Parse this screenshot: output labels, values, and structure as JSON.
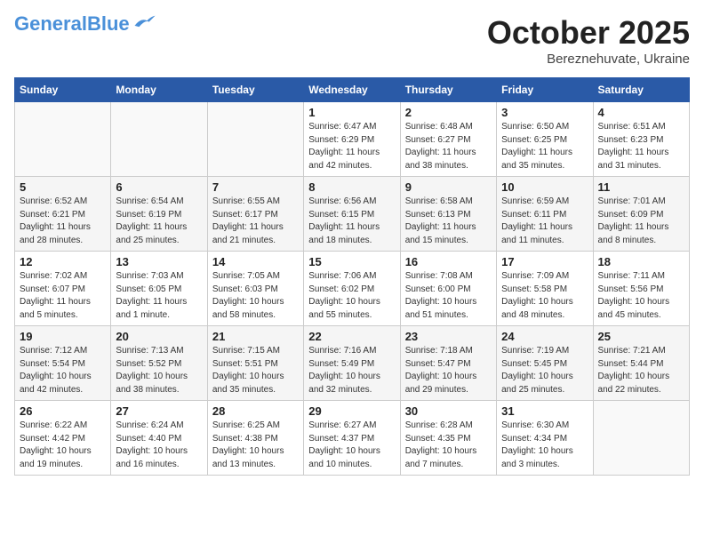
{
  "header": {
    "logo_line1": "General",
    "logo_line2": "Blue",
    "month": "October 2025",
    "location": "Bereznehuvate, Ukraine"
  },
  "weekdays": [
    "Sunday",
    "Monday",
    "Tuesday",
    "Wednesday",
    "Thursday",
    "Friday",
    "Saturday"
  ],
  "weeks": [
    [
      {
        "day": "",
        "info": ""
      },
      {
        "day": "",
        "info": ""
      },
      {
        "day": "",
        "info": ""
      },
      {
        "day": "1",
        "info": "Sunrise: 6:47 AM\nSunset: 6:29 PM\nDaylight: 11 hours\nand 42 minutes."
      },
      {
        "day": "2",
        "info": "Sunrise: 6:48 AM\nSunset: 6:27 PM\nDaylight: 11 hours\nand 38 minutes."
      },
      {
        "day": "3",
        "info": "Sunrise: 6:50 AM\nSunset: 6:25 PM\nDaylight: 11 hours\nand 35 minutes."
      },
      {
        "day": "4",
        "info": "Sunrise: 6:51 AM\nSunset: 6:23 PM\nDaylight: 11 hours\nand 31 minutes."
      }
    ],
    [
      {
        "day": "5",
        "info": "Sunrise: 6:52 AM\nSunset: 6:21 PM\nDaylight: 11 hours\nand 28 minutes."
      },
      {
        "day": "6",
        "info": "Sunrise: 6:54 AM\nSunset: 6:19 PM\nDaylight: 11 hours\nand 25 minutes."
      },
      {
        "day": "7",
        "info": "Sunrise: 6:55 AM\nSunset: 6:17 PM\nDaylight: 11 hours\nand 21 minutes."
      },
      {
        "day": "8",
        "info": "Sunrise: 6:56 AM\nSunset: 6:15 PM\nDaylight: 11 hours\nand 18 minutes."
      },
      {
        "day": "9",
        "info": "Sunrise: 6:58 AM\nSunset: 6:13 PM\nDaylight: 11 hours\nand 15 minutes."
      },
      {
        "day": "10",
        "info": "Sunrise: 6:59 AM\nSunset: 6:11 PM\nDaylight: 11 hours\nand 11 minutes."
      },
      {
        "day": "11",
        "info": "Sunrise: 7:01 AM\nSunset: 6:09 PM\nDaylight: 11 hours\nand 8 minutes."
      }
    ],
    [
      {
        "day": "12",
        "info": "Sunrise: 7:02 AM\nSunset: 6:07 PM\nDaylight: 11 hours\nand 5 minutes."
      },
      {
        "day": "13",
        "info": "Sunrise: 7:03 AM\nSunset: 6:05 PM\nDaylight: 11 hours\nand 1 minute."
      },
      {
        "day": "14",
        "info": "Sunrise: 7:05 AM\nSunset: 6:03 PM\nDaylight: 10 hours\nand 58 minutes."
      },
      {
        "day": "15",
        "info": "Sunrise: 7:06 AM\nSunset: 6:02 PM\nDaylight: 10 hours\nand 55 minutes."
      },
      {
        "day": "16",
        "info": "Sunrise: 7:08 AM\nSunset: 6:00 PM\nDaylight: 10 hours\nand 51 minutes."
      },
      {
        "day": "17",
        "info": "Sunrise: 7:09 AM\nSunset: 5:58 PM\nDaylight: 10 hours\nand 48 minutes."
      },
      {
        "day": "18",
        "info": "Sunrise: 7:11 AM\nSunset: 5:56 PM\nDaylight: 10 hours\nand 45 minutes."
      }
    ],
    [
      {
        "day": "19",
        "info": "Sunrise: 7:12 AM\nSunset: 5:54 PM\nDaylight: 10 hours\nand 42 minutes."
      },
      {
        "day": "20",
        "info": "Sunrise: 7:13 AM\nSunset: 5:52 PM\nDaylight: 10 hours\nand 38 minutes."
      },
      {
        "day": "21",
        "info": "Sunrise: 7:15 AM\nSunset: 5:51 PM\nDaylight: 10 hours\nand 35 minutes."
      },
      {
        "day": "22",
        "info": "Sunrise: 7:16 AM\nSunset: 5:49 PM\nDaylight: 10 hours\nand 32 minutes."
      },
      {
        "day": "23",
        "info": "Sunrise: 7:18 AM\nSunset: 5:47 PM\nDaylight: 10 hours\nand 29 minutes."
      },
      {
        "day": "24",
        "info": "Sunrise: 7:19 AM\nSunset: 5:45 PM\nDaylight: 10 hours\nand 25 minutes."
      },
      {
        "day": "25",
        "info": "Sunrise: 7:21 AM\nSunset: 5:44 PM\nDaylight: 10 hours\nand 22 minutes."
      }
    ],
    [
      {
        "day": "26",
        "info": "Sunrise: 6:22 AM\nSunset: 4:42 PM\nDaylight: 10 hours\nand 19 minutes."
      },
      {
        "day": "27",
        "info": "Sunrise: 6:24 AM\nSunset: 4:40 PM\nDaylight: 10 hours\nand 16 minutes."
      },
      {
        "day": "28",
        "info": "Sunrise: 6:25 AM\nSunset: 4:38 PM\nDaylight: 10 hours\nand 13 minutes."
      },
      {
        "day": "29",
        "info": "Sunrise: 6:27 AM\nSunset: 4:37 PM\nDaylight: 10 hours\nand 10 minutes."
      },
      {
        "day": "30",
        "info": "Sunrise: 6:28 AM\nSunset: 4:35 PM\nDaylight: 10 hours\nand 7 minutes."
      },
      {
        "day": "31",
        "info": "Sunrise: 6:30 AM\nSunset: 4:34 PM\nDaylight: 10 hours\nand 3 minutes."
      },
      {
        "day": "",
        "info": ""
      }
    ]
  ]
}
